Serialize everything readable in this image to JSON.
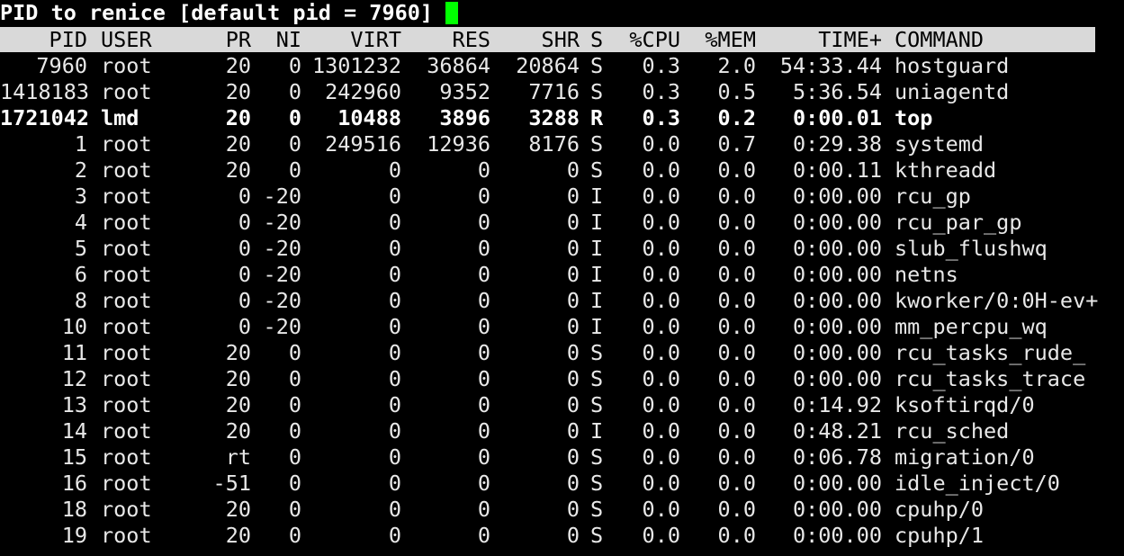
{
  "prompt": {
    "text": "PID to renice [default pid = 7960]",
    "cursor_color": "#00ff00"
  },
  "colors": {
    "background": "#000000",
    "foreground": "#e8e8e8",
    "header_background": "#d9d9d9",
    "header_foreground": "#000000"
  },
  "columns": {
    "pid": "PID",
    "user": "USER",
    "pr": "PR",
    "ni": "NI",
    "virt": "VIRT",
    "res": "RES",
    "shr": "SHR",
    "s": "S",
    "cpu": "%CPU",
    "mem": "%MEM",
    "time": "TIME+",
    "command": "COMMAND"
  },
  "processes": [
    {
      "pid": "7960",
      "user": "root",
      "pr": "20",
      "ni": "0",
      "virt": "1301232",
      "res": "36864",
      "shr": "20864",
      "s": "S",
      "cpu": "0.3",
      "mem": "2.0",
      "time": "54:33.44",
      "command": "hostguard",
      "bold": false
    },
    {
      "pid": "1418183",
      "user": "root",
      "pr": "20",
      "ni": "0",
      "virt": "242960",
      "res": "9352",
      "shr": "7716",
      "s": "S",
      "cpu": "0.3",
      "mem": "0.5",
      "time": "5:36.54",
      "command": "uniagentd",
      "bold": false
    },
    {
      "pid": "1721042",
      "user": "lmd",
      "pr": "20",
      "ni": "0",
      "virt": "10488",
      "res": "3896",
      "shr": "3288",
      "s": "R",
      "cpu": "0.3",
      "mem": "0.2",
      "time": "0:00.01",
      "command": "top",
      "bold": true
    },
    {
      "pid": "1",
      "user": "root",
      "pr": "20",
      "ni": "0",
      "virt": "249516",
      "res": "12936",
      "shr": "8176",
      "s": "S",
      "cpu": "0.0",
      "mem": "0.7",
      "time": "0:29.38",
      "command": "systemd",
      "bold": false
    },
    {
      "pid": "2",
      "user": "root",
      "pr": "20",
      "ni": "0",
      "virt": "0",
      "res": "0",
      "shr": "0",
      "s": "S",
      "cpu": "0.0",
      "mem": "0.0",
      "time": "0:00.11",
      "command": "kthreadd",
      "bold": false
    },
    {
      "pid": "3",
      "user": "root",
      "pr": "0",
      "ni": "-20",
      "virt": "0",
      "res": "0",
      "shr": "0",
      "s": "I",
      "cpu": "0.0",
      "mem": "0.0",
      "time": "0:00.00",
      "command": "rcu_gp",
      "bold": false
    },
    {
      "pid": "4",
      "user": "root",
      "pr": "0",
      "ni": "-20",
      "virt": "0",
      "res": "0",
      "shr": "0",
      "s": "I",
      "cpu": "0.0",
      "mem": "0.0",
      "time": "0:00.00",
      "command": "rcu_par_gp",
      "bold": false
    },
    {
      "pid": "5",
      "user": "root",
      "pr": "0",
      "ni": "-20",
      "virt": "0",
      "res": "0",
      "shr": "0",
      "s": "I",
      "cpu": "0.0",
      "mem": "0.0",
      "time": "0:00.00",
      "command": "slub_flushwq",
      "bold": false
    },
    {
      "pid": "6",
      "user": "root",
      "pr": "0",
      "ni": "-20",
      "virt": "0",
      "res": "0",
      "shr": "0",
      "s": "I",
      "cpu": "0.0",
      "mem": "0.0",
      "time": "0:00.00",
      "command": "netns",
      "bold": false
    },
    {
      "pid": "8",
      "user": "root",
      "pr": "0",
      "ni": "-20",
      "virt": "0",
      "res": "0",
      "shr": "0",
      "s": "I",
      "cpu": "0.0",
      "mem": "0.0",
      "time": "0:00.00",
      "command": "kworker/0:0H-ev+",
      "bold": false
    },
    {
      "pid": "10",
      "user": "root",
      "pr": "0",
      "ni": "-20",
      "virt": "0",
      "res": "0",
      "shr": "0",
      "s": "I",
      "cpu": "0.0",
      "mem": "0.0",
      "time": "0:00.00",
      "command": "mm_percpu_wq",
      "bold": false
    },
    {
      "pid": "11",
      "user": "root",
      "pr": "20",
      "ni": "0",
      "virt": "0",
      "res": "0",
      "shr": "0",
      "s": "S",
      "cpu": "0.0",
      "mem": "0.0",
      "time": "0:00.00",
      "command": "rcu_tasks_rude_",
      "bold": false
    },
    {
      "pid": "12",
      "user": "root",
      "pr": "20",
      "ni": "0",
      "virt": "0",
      "res": "0",
      "shr": "0",
      "s": "S",
      "cpu": "0.0",
      "mem": "0.0",
      "time": "0:00.00",
      "command": "rcu_tasks_trace",
      "bold": false
    },
    {
      "pid": "13",
      "user": "root",
      "pr": "20",
      "ni": "0",
      "virt": "0",
      "res": "0",
      "shr": "0",
      "s": "S",
      "cpu": "0.0",
      "mem": "0.0",
      "time": "0:14.92",
      "command": "ksoftirqd/0",
      "bold": false
    },
    {
      "pid": "14",
      "user": "root",
      "pr": "20",
      "ni": "0",
      "virt": "0",
      "res": "0",
      "shr": "0",
      "s": "I",
      "cpu": "0.0",
      "mem": "0.0",
      "time": "0:48.21",
      "command": "rcu_sched",
      "bold": false
    },
    {
      "pid": "15",
      "user": "root",
      "pr": "rt",
      "ni": "0",
      "virt": "0",
      "res": "0",
      "shr": "0",
      "s": "S",
      "cpu": "0.0",
      "mem": "0.0",
      "time": "0:06.78",
      "command": "migration/0",
      "bold": false
    },
    {
      "pid": "16",
      "user": "root",
      "pr": "-51",
      "ni": "0",
      "virt": "0",
      "res": "0",
      "shr": "0",
      "s": "S",
      "cpu": "0.0",
      "mem": "0.0",
      "time": "0:00.00",
      "command": "idle_inject/0",
      "bold": false
    },
    {
      "pid": "18",
      "user": "root",
      "pr": "20",
      "ni": "0",
      "virt": "0",
      "res": "0",
      "shr": "0",
      "s": "S",
      "cpu": "0.0",
      "mem": "0.0",
      "time": "0:00.00",
      "command": "cpuhp/0",
      "bold": false
    },
    {
      "pid": "19",
      "user": "root",
      "pr": "20",
      "ni": "0",
      "virt": "0",
      "res": "0",
      "shr": "0",
      "s": "S",
      "cpu": "0.0",
      "mem": "0.0",
      "time": "0:00.00",
      "command": "cpuhp/1",
      "bold": false
    }
  ]
}
